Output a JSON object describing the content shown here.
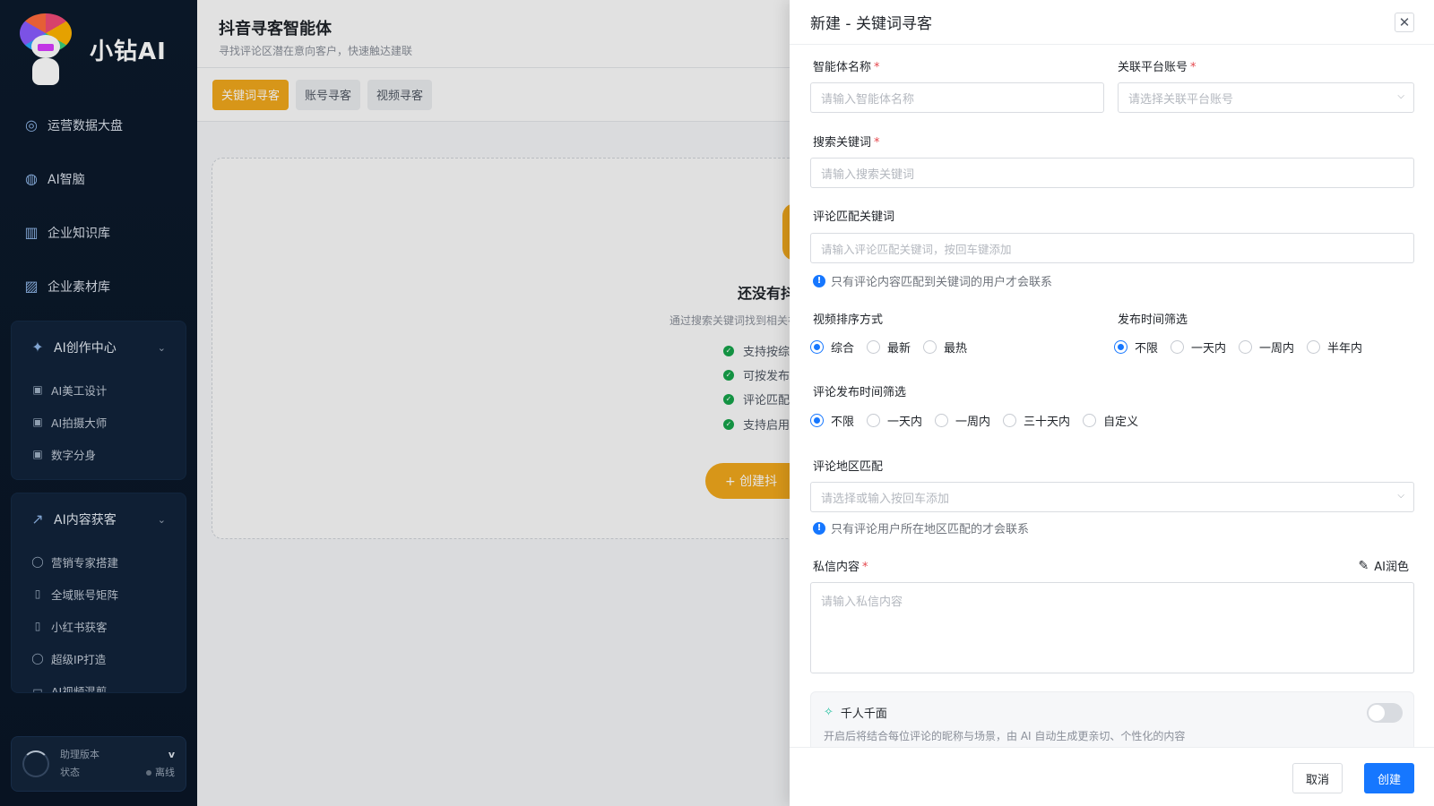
{
  "sidebar": {
    "brand": "小钻AI",
    "mascot_tag": "小钻AI",
    "nav": [
      {
        "label": "运营数据大盘",
        "icon": "dashboard-icon"
      },
      {
        "label": "AI智脑",
        "icon": "brain-icon"
      },
      {
        "label": "企业知识库",
        "icon": "library-icon"
      },
      {
        "label": "企业素材库",
        "icon": "image-icon"
      }
    ],
    "group_create": {
      "label": "AI创作中心",
      "items": [
        "AI美工设计",
        "AI拍摄大师",
        "数字分身"
      ]
    },
    "group_leads": {
      "label": "AI内容获客",
      "items": [
        "营销专家搭建",
        "全域账号矩阵",
        "小红书获客",
        "超级IP打造",
        "AI视频混剪"
      ]
    },
    "footer": {
      "line1": "助理版本",
      "line2": "状态",
      "version": "v",
      "status": "离线"
    }
  },
  "main": {
    "title": "抖音寻客智能体",
    "subtitle": "寻找评论区潜在意向客户，快速触达建联",
    "tabs": [
      "关键词寻客",
      "账号寻客",
      "视频寻客"
    ],
    "empty_title": "还没有抖音",
    "empty_desc": "通过搜索关键词找到相关视",
    "features": [
      "支持按综合",
      "可按发布时",
      "评论匹配关",
      "支持启用自"
    ],
    "create_btn": "+ 创建抖"
  },
  "drawer": {
    "title": "新建 - 关键词寻客",
    "fields": {
      "agent_name": {
        "label": "智能体名称",
        "placeholder": "请输入智能体名称"
      },
      "platform_account": {
        "label": "关联平台账号",
        "placeholder": "请选择关联平台账号"
      },
      "search_keyword": {
        "label": "搜索关键词",
        "placeholder": "请输入搜索关键词"
      },
      "comment_keyword": {
        "label": "评论匹配关键词",
        "placeholder": "请输入评论匹配关键词，按回车键添加",
        "hint": "只有评论内容匹配到关键词的用户才会联系"
      },
      "video_sort": {
        "label": "视频排序方式",
        "options": [
          "综合",
          "最新",
          "最热"
        ],
        "selected": "综合"
      },
      "publish_time": {
        "label": "发布时间筛选",
        "options": [
          "不限",
          "一天内",
          "一周内",
          "半年内"
        ],
        "selected": "不限"
      },
      "comment_time": {
        "label": "评论发布时间筛选",
        "options": [
          "不限",
          "一天内",
          "一周内",
          "三十天内",
          "自定义"
        ],
        "selected": "不限"
      },
      "region": {
        "label": "评论地区匹配",
        "placeholder": "请选择或输入按回车添加",
        "hint": "只有评论用户所在地区匹配的才会联系"
      },
      "message": {
        "label": "私信内容",
        "placeholder": "请输入私信内容",
        "ai_polish": "AI润色"
      }
    },
    "feature_card": {
      "title": "千人千面",
      "desc": "开启后将结合每位评论的昵称与场景，由 AI 自动生成更亲切、个性化的内容"
    },
    "buttons": {
      "cancel": "取消",
      "create": "创建"
    }
  }
}
